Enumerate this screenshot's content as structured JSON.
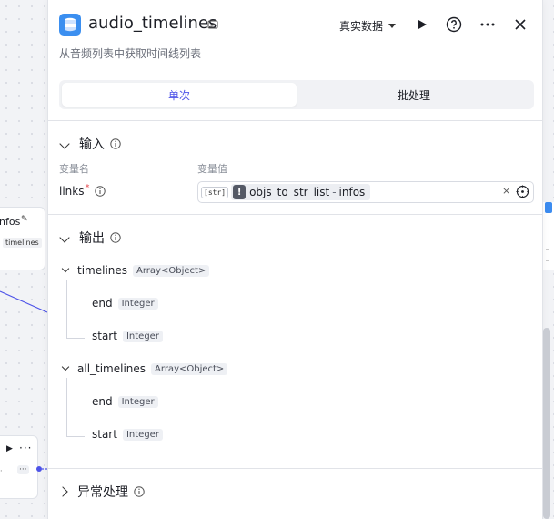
{
  "background": {
    "node_title_partial": "nfos",
    "node_tag": "timelines"
  },
  "panel": {
    "title": "audio_timelines",
    "description": "从音频列表中获取时间线列表",
    "mode_select": "真实数据",
    "tabs": [
      {
        "label": "单次",
        "active": true
      },
      {
        "label": "批处理",
        "active": false
      }
    ],
    "input_section": {
      "label": "输入",
      "col_name": "变量名",
      "col_value": "变量值",
      "params": [
        {
          "name": "links",
          "required_mark": "*",
          "type_tag": "[str]",
          "ref_source": "objs_to_str_list",
          "ref_sep": "-",
          "ref_field": "infos",
          "clear": "×"
        }
      ]
    },
    "output_section": {
      "label": "输出",
      "items": [
        {
          "name": "timelines",
          "type": "Array<Object>",
          "children": [
            {
              "name": "end",
              "type": "Integer"
            },
            {
              "name": "start",
              "type": "Integer"
            }
          ]
        },
        {
          "name": "all_timelines",
          "type": "Array<Object>",
          "children": [
            {
              "name": "end",
              "type": "Integer"
            },
            {
              "name": "start",
              "type": "Integer"
            }
          ]
        }
      ]
    },
    "exception_section": {
      "label": "异常处理"
    }
  },
  "icons": {
    "node": "database-stack-icon",
    "title_edit": "edit-icon",
    "run": "play-icon",
    "help": "help-circle-icon",
    "more": "more-dots-icon",
    "close": "close-icon",
    "info": "info-circle-icon",
    "target": "target-icon"
  },
  "colors": {
    "accent": "#4d53e8",
    "required": "#e5484d"
  }
}
